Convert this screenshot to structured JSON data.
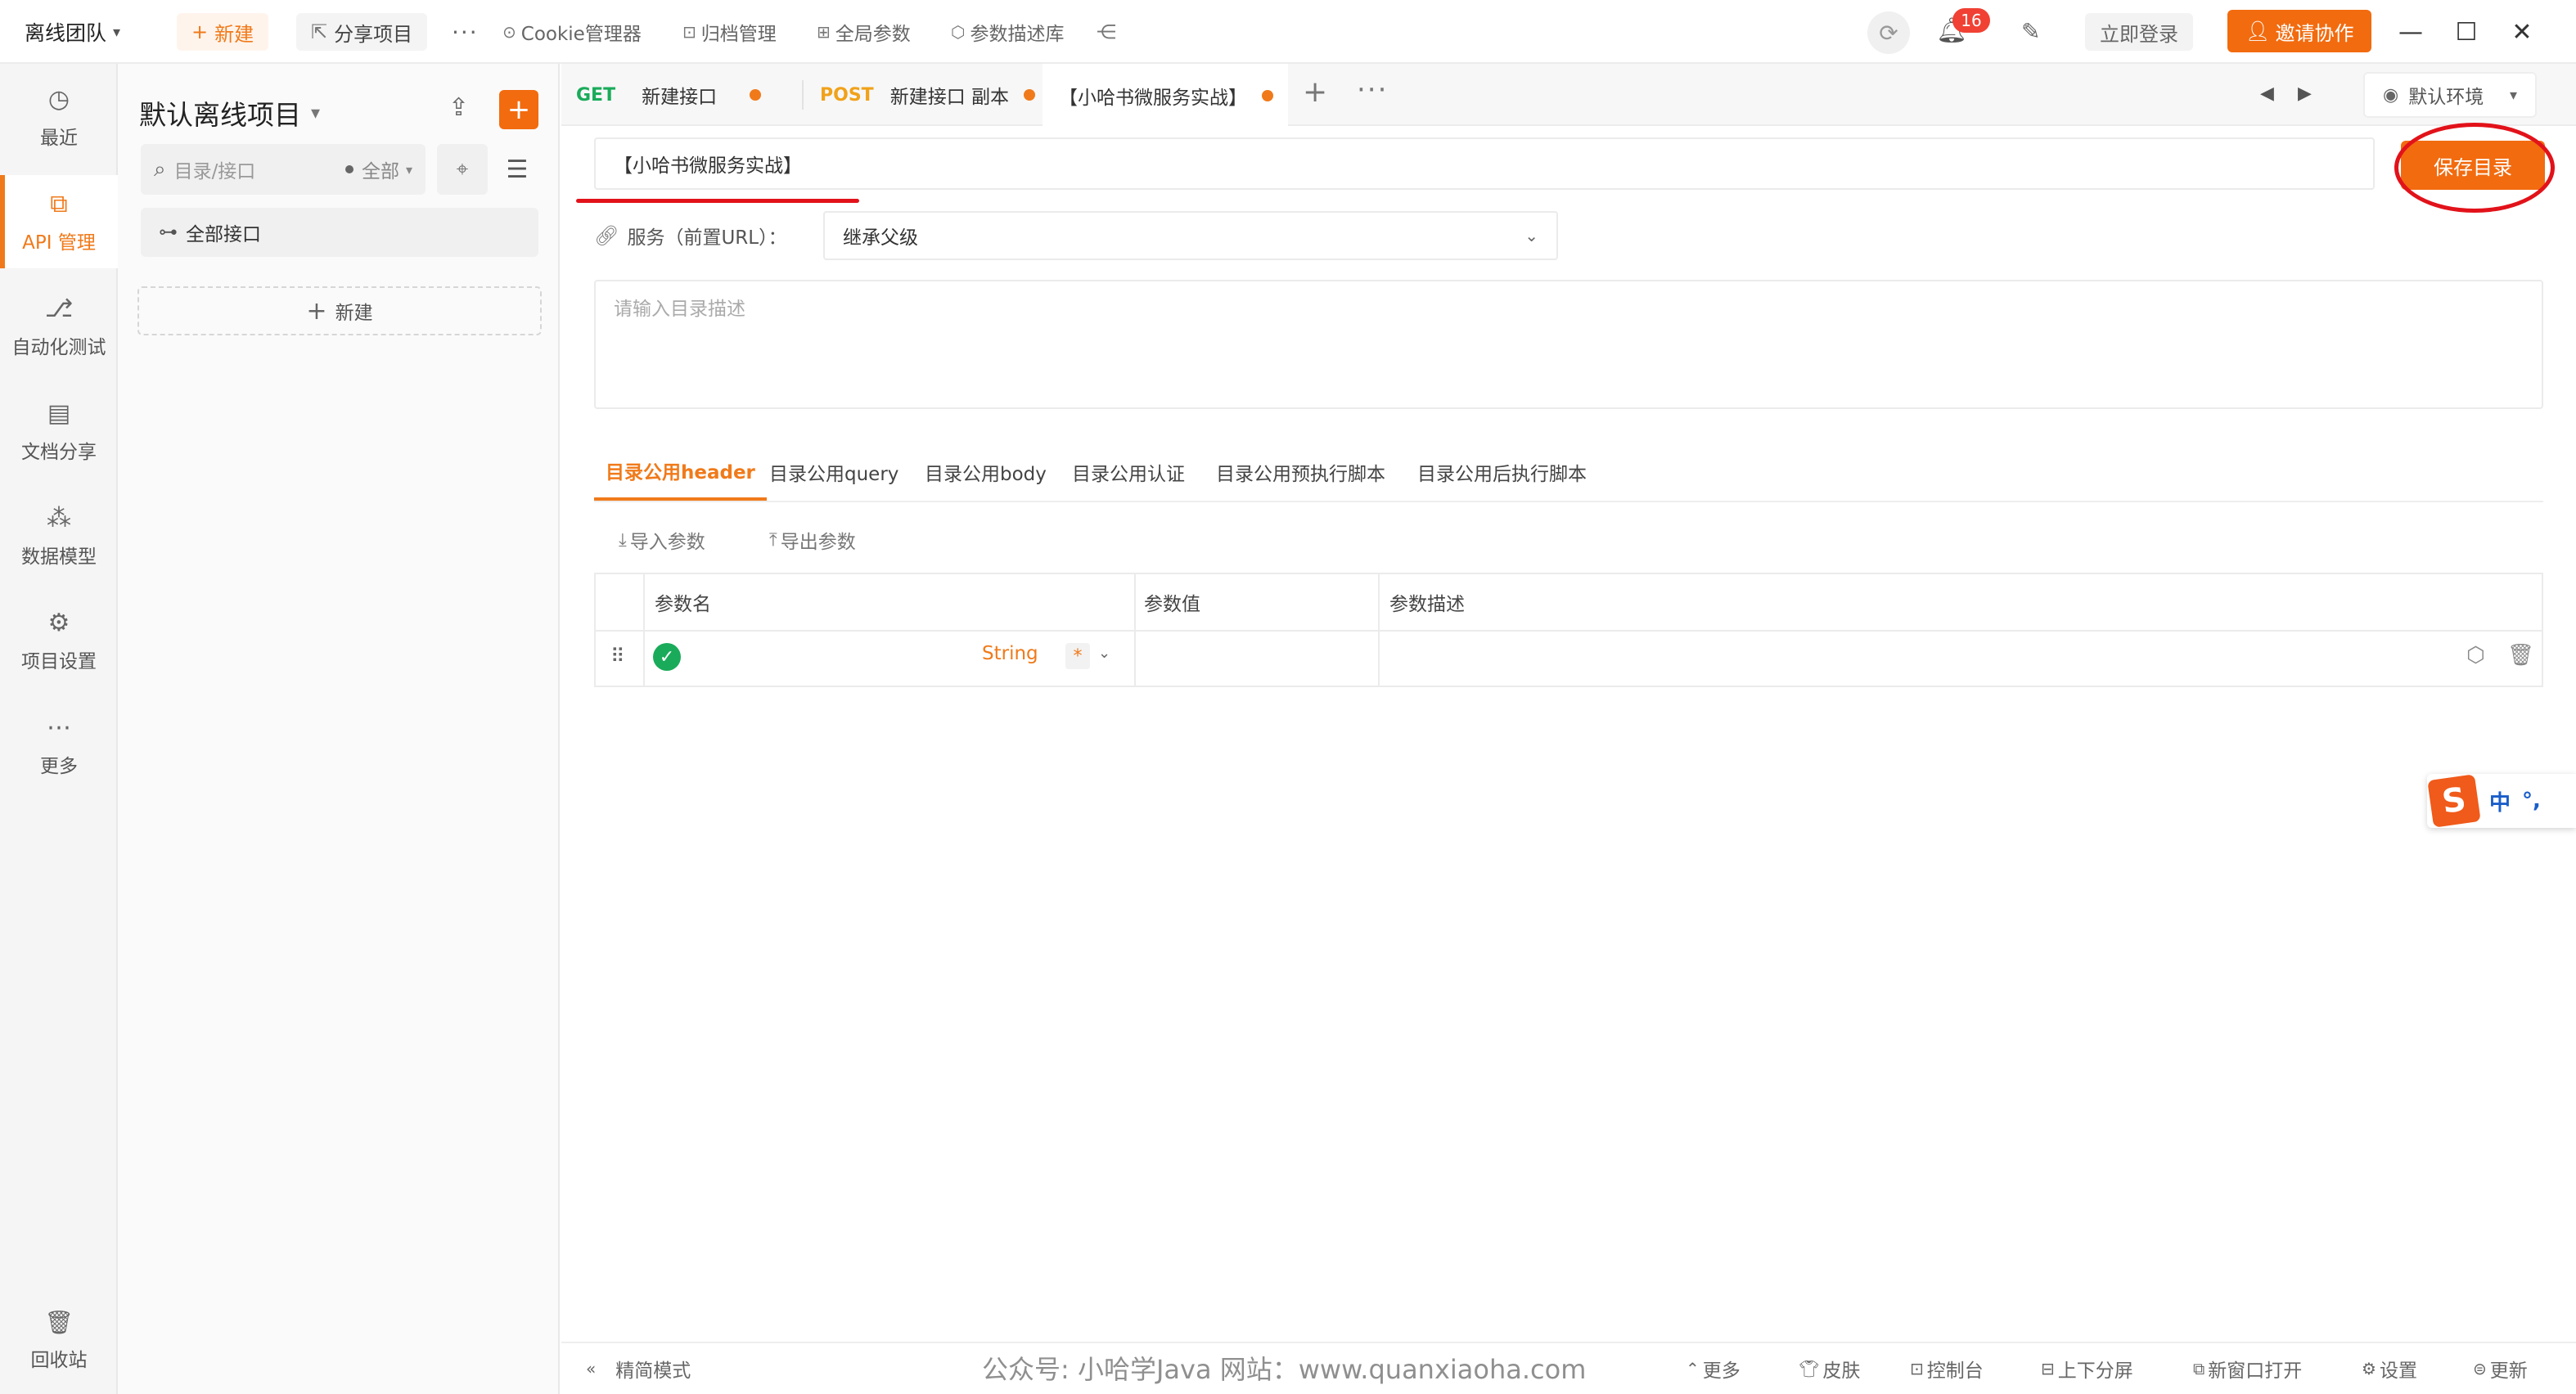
{
  "topbar": {
    "team": "离线团队",
    "new_label": "新建",
    "share_label": "分享项目",
    "more": "···",
    "links": [
      {
        "label": "Cookie管理器",
        "icon": "cookie-icon"
      },
      {
        "label": "归档管理",
        "icon": "archive-icon"
      },
      {
        "label": "全局参数",
        "icon": "global-params-icon"
      },
      {
        "label": "参数描述库",
        "icon": "param-lib-icon"
      }
    ],
    "notification_count": "16",
    "login_label": "立即登录",
    "invite_label": "邀请协作"
  },
  "rail": {
    "items": [
      {
        "label": "最近",
        "icon": "clock-icon"
      },
      {
        "label": "API 管理",
        "icon": "api-icon",
        "active": true
      },
      {
        "label": "自动化测试",
        "icon": "automation-icon"
      },
      {
        "label": "文档分享",
        "icon": "doc-share-icon"
      },
      {
        "label": "数据模型",
        "icon": "data-model-icon"
      },
      {
        "label": "项目设置",
        "icon": "project-settings-icon"
      },
      {
        "label": "更多",
        "icon": "more-icon"
      }
    ],
    "trash_label": "回收站"
  },
  "panel": {
    "project_title": "默认离线项目",
    "search_placeholder": "目录/接口",
    "filter_label": "全部",
    "all_api_label": "全部接口",
    "new_label": "新建"
  },
  "tabs": {
    "items": [
      {
        "method": "GET",
        "title": "新建接口",
        "unsaved": true
      },
      {
        "method": "POST",
        "title": "新建接口 副本",
        "unsaved": true
      },
      {
        "method": "",
        "title": "【小哈书微服务实战】",
        "unsaved": true,
        "active": true
      }
    ],
    "environment": "默认环境"
  },
  "editor": {
    "dir_name": "【小哈书微服务实战】",
    "save_label": "保存目录",
    "service_label": "服务（前置URL）：",
    "service_value": "继承父级",
    "desc_placeholder": "请输入目录描述",
    "subtabs": [
      "目录公用header",
      "目录公用query",
      "目录公用body",
      "目录公用认证",
      "目录公用预执行脚本",
      "目录公用后执行脚本"
    ],
    "import_label": "导入参数",
    "export_label": "导出参数",
    "table": {
      "columns": [
        "参数名",
        "参数值",
        "参数描述"
      ],
      "rows": [
        {
          "name": "",
          "type": "String",
          "required": "*",
          "value": "",
          "desc": ""
        }
      ]
    }
  },
  "ime": {
    "zh": "中",
    "punct": "°,"
  },
  "status": {
    "simple_mode": "精简模式",
    "watermark": "公众号: 小哈学Java  网站：www.quanxiaoha.com",
    "items": [
      "更多",
      "皮肤",
      "控制台",
      "上下分屏",
      "新窗口打开",
      "设置",
      "更新"
    ]
  },
  "colors": {
    "accent": "#f26b0f",
    "get": "#1aab5a",
    "post": "#f0a21a",
    "annotation": "#e2121a"
  }
}
